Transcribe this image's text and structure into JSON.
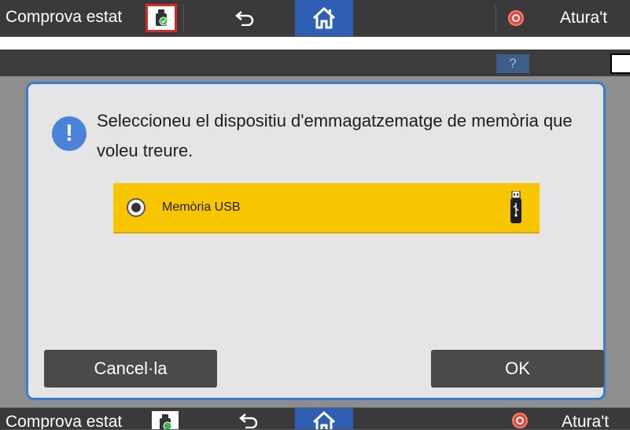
{
  "top_bar": {
    "check_status_label": "Comprova estat",
    "stop_label": "Atura't",
    "icons": [
      "usb-memory-icon",
      "back-icon",
      "home-icon",
      "stop-icon"
    ]
  },
  "header_strip": {
    "help_label": "?",
    "icons": [
      "moon-icon"
    ]
  },
  "dialog": {
    "message": "Seleccioneu el dispositiu d'emmagatzematge de memòria que voleu treure.",
    "options": [
      {
        "label": "Memòria USB",
        "selected": true,
        "icon": "usb-stick-icon"
      }
    ],
    "cancel_label": "Cancel·la",
    "ok_label": "OK"
  },
  "bottom_bar": {
    "check_status_label": "Comprova estat",
    "stop_label": "Atura't"
  },
  "colors": {
    "bar_bg": "#3a3a3a",
    "home_blue": "#2f5fb3",
    "dialog_border": "#3a7bd5",
    "option_yellow": "#f7c600",
    "stop_red": "#e2463a",
    "highlight_red": "#d8272d"
  }
}
